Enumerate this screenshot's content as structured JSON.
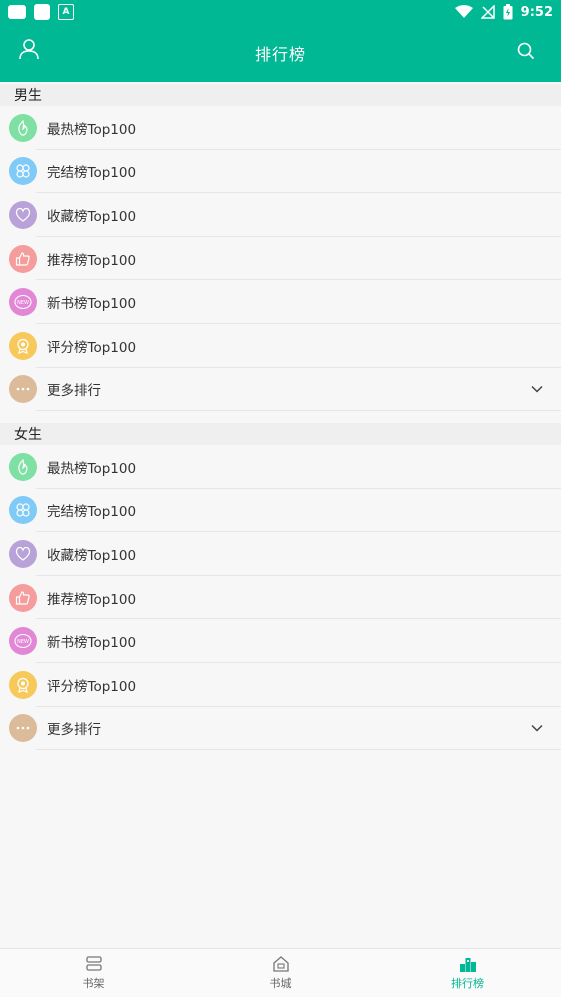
{
  "status_bar": {
    "time": "9:52",
    "a_badge": "A"
  },
  "app_bar": {
    "title": "排行榜"
  },
  "sections": [
    {
      "header": "男生",
      "items": [
        {
          "label": "最热榜Top100",
          "icon": "flame-icon",
          "color": "#7ee0a3"
        },
        {
          "label": "完结榜Top100",
          "icon": "knot-icon",
          "color": "#7fcaf6"
        },
        {
          "label": "收藏榜Top100",
          "icon": "heart-icon",
          "color": "#b9a2d8"
        },
        {
          "label": "推荐榜Top100",
          "icon": "thumbs-up-icon",
          "color": "#f59c9c"
        },
        {
          "label": "新书榜Top100",
          "icon": "new-badge-icon",
          "color": "#e187d6"
        },
        {
          "label": "评分榜Top100",
          "icon": "medal-icon",
          "color": "#f7c95a"
        },
        {
          "label": "更多排行",
          "icon": "more-icon",
          "color": "#dcbb9a",
          "expandable": true
        }
      ]
    },
    {
      "header": "女生",
      "items": [
        {
          "label": "最热榜Top100",
          "icon": "flame-icon",
          "color": "#7ee0a3"
        },
        {
          "label": "完结榜Top100",
          "icon": "knot-icon",
          "color": "#7fcaf6"
        },
        {
          "label": "收藏榜Top100",
          "icon": "heart-icon",
          "color": "#b9a2d8"
        },
        {
          "label": "推荐榜Top100",
          "icon": "thumbs-up-icon",
          "color": "#f59c9c"
        },
        {
          "label": "新书榜Top100",
          "icon": "new-badge-icon",
          "color": "#e187d6"
        },
        {
          "label": "评分榜Top100",
          "icon": "medal-icon",
          "color": "#f7c95a"
        },
        {
          "label": "更多排行",
          "icon": "more-icon",
          "color": "#dcbb9a",
          "expandable": true
        }
      ]
    }
  ],
  "bottom_nav": [
    {
      "label": "书架",
      "icon": "bookshelf-icon",
      "active": false
    },
    {
      "label": "书城",
      "icon": "bookstore-icon",
      "active": false
    },
    {
      "label": "排行榜",
      "icon": "ranking-icon",
      "active": true
    }
  ],
  "colors": {
    "accent": "#00b894"
  }
}
